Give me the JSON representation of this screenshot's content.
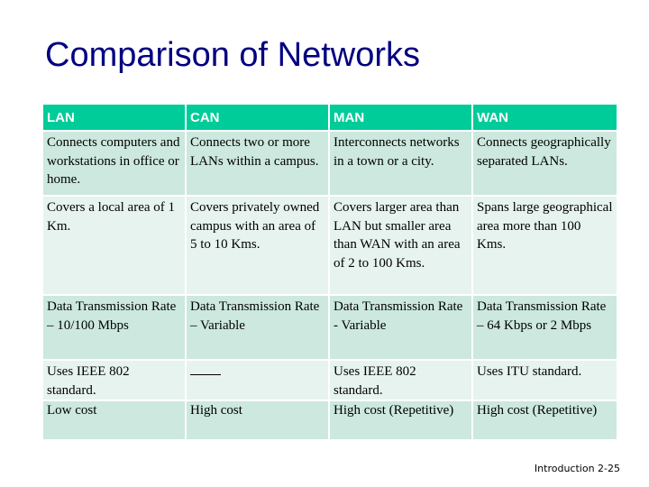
{
  "slide": {
    "title": "Comparison of Networks",
    "footer": "Introduction 2-25"
  },
  "table": {
    "headers": [
      "LAN",
      "CAN",
      "MAN",
      "WAN"
    ],
    "rows": [
      [
        "Connects computers and workstations in office or home.",
        "Connects two or more LANs within a campus.",
        "Interconnects networks in a town or a city.",
        "Connects geographically separated LANs."
      ],
      [
        "Covers a local area of 1 Km.",
        "Covers privately owned campus with an area of 5 to 10 Kms.",
        "Covers larger area than LAN but smaller area than WAN with an area of 2 to 100 Kms.",
        "Spans large geographical area more than 100 Kms."
      ],
      [
        "Data Transmission Rate – 10/100 Mbps",
        "Data Transmission Rate – Variable",
        "Data Transmission Rate - Variable",
        "Data Transmission Rate – 64 Kbps or 2 Mbps"
      ],
      [
        "Uses IEEE 802 standard.",
        "",
        "Uses IEEE 802 standard.",
        "Uses ITU standard."
      ],
      [
        "Low cost",
        "High cost",
        "High cost (Repetitive)",
        "High cost (Repetitive)"
      ]
    ]
  },
  "colors": {
    "title": "#000080",
    "header_bg": "#00cc99",
    "header_text": "#ffffff",
    "row_dark_bg": "#cce8df",
    "row_light_bg": "#e6f3ee"
  }
}
